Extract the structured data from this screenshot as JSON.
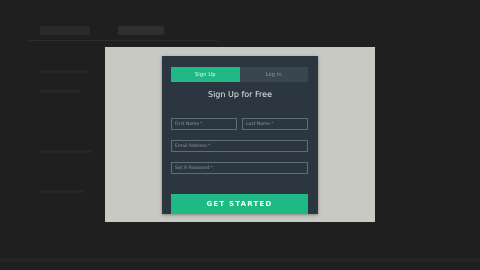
{
  "modal": {
    "tabs": [
      {
        "label": "Sign Up",
        "active": true
      },
      {
        "label": "Log In",
        "active": false
      }
    ],
    "title": "Sign Up for Free",
    "fields": {
      "first_name": {
        "placeholder": "First Name",
        "required_mark": "*"
      },
      "last_name": {
        "placeholder": "Last Name",
        "required_mark": "*"
      },
      "email": {
        "placeholder": "Email Address",
        "required_mark": "*"
      },
      "password": {
        "placeholder": "Set A Password",
        "required_mark": "*"
      }
    },
    "submit_label": "GET STARTED"
  },
  "colors": {
    "accent": "#1fb985",
    "card_background": "#2b3640",
    "stage_background": "#c9c9c3",
    "page_background": "#1f1f1f"
  }
}
